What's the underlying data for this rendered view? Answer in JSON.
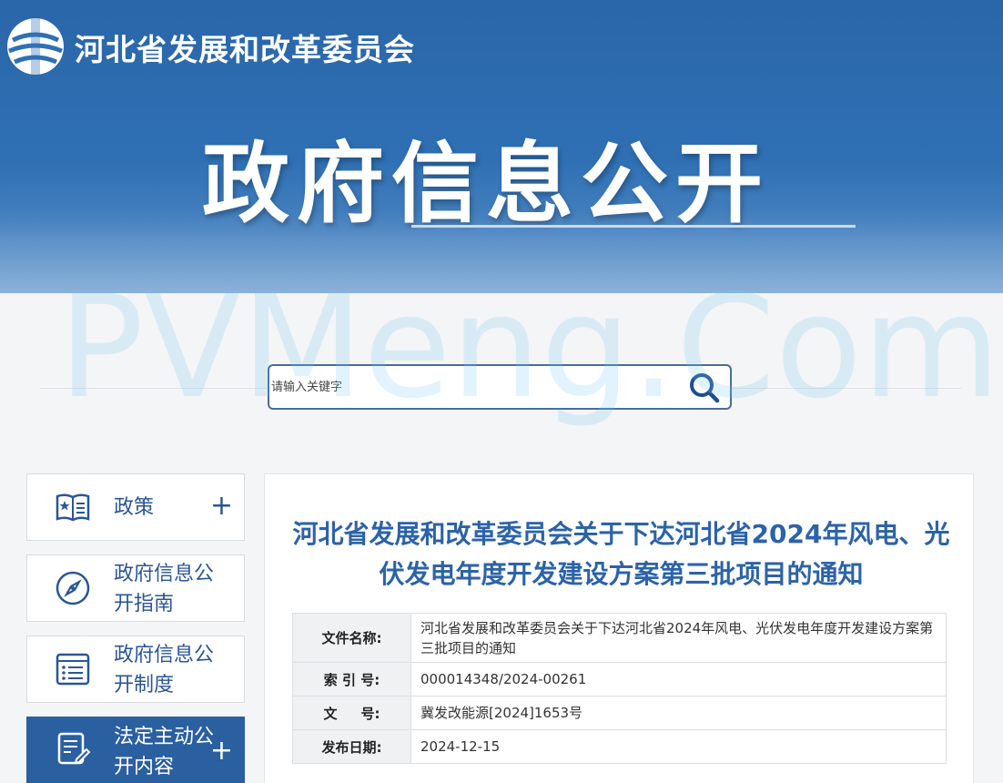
{
  "header": {
    "org_name": "河北省发展和改革委员会",
    "banner_title": "政府信息公开"
  },
  "watermark": "PVMeng.Com",
  "search": {
    "placeholder": "请输入关键字"
  },
  "sidebar": {
    "items": [
      {
        "label": "政策",
        "icon": "star-book-icon",
        "has_plus": true,
        "active": false
      },
      {
        "label": "政府信息公开指南",
        "icon": "compass-icon",
        "has_plus": false,
        "active": false
      },
      {
        "label": "政府信息公开制度",
        "icon": "list-icon",
        "has_plus": false,
        "active": false
      },
      {
        "label": "法定主动公开内容",
        "icon": "document-edit-icon",
        "has_plus": true,
        "active": true
      }
    ],
    "plus_symbol": "+"
  },
  "document": {
    "title": "河北省发展和改革委员会关于下达河北省2024年风电、光伏发电年度开发建设方案第三批项目的通知",
    "fields": [
      {
        "key": "文件名称:",
        "value": "河北省发展和改革委员会关于下达河北省2024年风电、光伏发电年度开发建设方案第三批项目的通知"
      },
      {
        "key": "索 引 号:",
        "value": "000014348/2024-00261"
      },
      {
        "key": "文     号:",
        "value": "冀发改能源[2024]1653号"
      },
      {
        "key": "发布日期:",
        "value": "2024-12-15"
      }
    ]
  },
  "colors": {
    "banner_blue": "#2f70b4",
    "accent_blue": "#2a5fa0",
    "title_blue": "#2c63a8"
  }
}
